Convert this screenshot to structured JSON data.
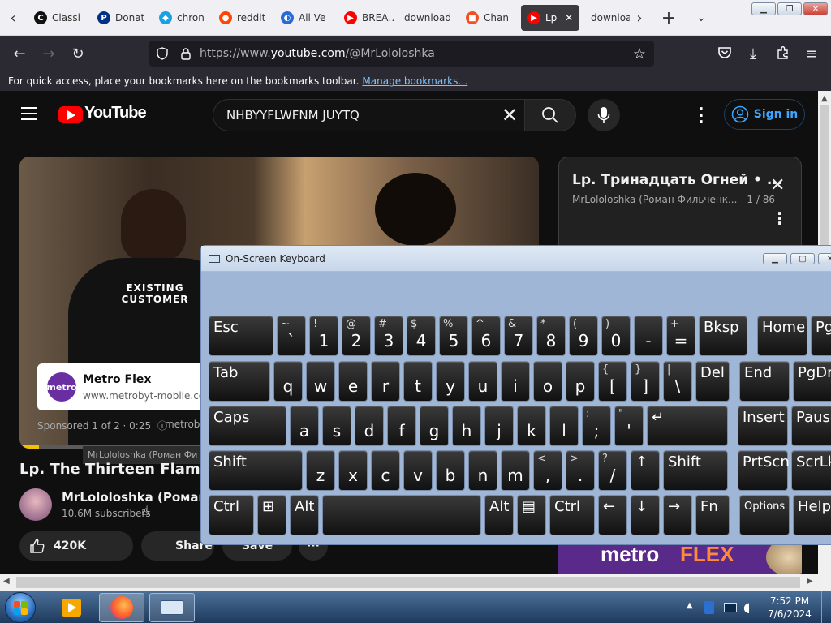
{
  "browser": {
    "tabs": [
      {
        "title": "Classi",
        "fav": "C",
        "color": "#111111"
      },
      {
        "title": "Donat",
        "fav": "P",
        "color": "#003087"
      },
      {
        "title": "chron",
        "fav": "◆",
        "color": "#19a1e2"
      },
      {
        "title": "reddit",
        "fav": "●",
        "color": "#ff4500"
      },
      {
        "title": "All Ve",
        "fav": "◐",
        "color": "#2a6ad8"
      },
      {
        "title": "BREA… AUTO",
        "fav": "▶",
        "color": "#ff0000"
      },
      {
        "title": "download",
        "fav": "",
        "color": ""
      },
      {
        "title": "Chan",
        "fav": "■",
        "color": "#f25022"
      },
      {
        "title": "Lp",
        "fav": "▶",
        "color": "#ff0000"
      },
      {
        "title": "downloa",
        "fav": "",
        "color": ""
      }
    ],
    "url_prefix": "https://www.",
    "url_domain": "youtube.com",
    "url_path": "/@MrLololoshka",
    "bookmarks_message": "For quick access, place your bookmarks here on the bookmarks toolbar.",
    "manage_bookmarks": "Manage bookmarks…"
  },
  "youtube": {
    "logo_text": "YouTube",
    "search_value": "NHBYYFLWFNM JUYTQ",
    "sign_in": "Sign in",
    "ad": {
      "title": "Metro Flex",
      "url": "www.metrobyt-mobile.com",
      "logo": "metro",
      "sponsored": "Sponsored 1 of 2 · 0:25",
      "advertiser": "metroby"
    },
    "shirt_text": "EXISTING CUSTOMER",
    "tooltip": "MrLololoshka (Роман Фи",
    "video_title": "Lp. The Thirteen Flames",
    "channel_name": "MrLololoshka (Роман Ф",
    "subscribers": "10.6M subscribers",
    "likes": "420K",
    "share": "Share",
    "save": "Save",
    "playlist_title": "Lp. Тринадцать Огней • ...",
    "playlist_sub": "MrLololoshka (Роман Фильченк...",
    "playlist_pos": " - 1 / 86",
    "banner_metro": "metro",
    "banner_flex": "FLEX"
  },
  "osk": {
    "title": "On-Screen Keyboard",
    "rows": [
      [
        {
          "main": "Esc",
          "w": 80,
          "type": "word"
        },
        {
          "main": "`",
          "shift": "~"
        },
        {
          "main": "1",
          "shift": "!"
        },
        {
          "main": "2",
          "shift": "@"
        },
        {
          "main": "3",
          "shift": "#"
        },
        {
          "main": "4",
          "shift": "$"
        },
        {
          "main": "5",
          "shift": "%"
        },
        {
          "main": "6",
          "shift": "^"
        },
        {
          "main": "7",
          "shift": "&"
        },
        {
          "main": "8",
          "shift": "*"
        },
        {
          "main": "9",
          "shift": "("
        },
        {
          "main": "0",
          "shift": ")"
        },
        {
          "main": "-",
          "shift": "_"
        },
        {
          "main": "=",
          "shift": "+"
        },
        {
          "main": "Bksp",
          "w": 60,
          "type": "word"
        },
        {
          "main": "Home",
          "w": 62,
          "type": "word",
          "gap": 8
        },
        {
          "main": "PgUp",
          "w": 62,
          "type": "word"
        }
      ],
      [
        {
          "main": "Tab",
          "w": 76,
          "type": "word"
        },
        {
          "main": "q"
        },
        {
          "main": "w"
        },
        {
          "main": "e"
        },
        {
          "main": "r"
        },
        {
          "main": "t"
        },
        {
          "main": "y"
        },
        {
          "main": "u"
        },
        {
          "main": "i"
        },
        {
          "main": "o"
        },
        {
          "main": "p"
        },
        {
          "main": "[",
          "shift": "{"
        },
        {
          "main": "]",
          "shift": "}"
        },
        {
          "main": "\\",
          "shift": "|"
        },
        {
          "main": "Del",
          "w": 42,
          "type": "word"
        },
        {
          "main": "End",
          "w": 62,
          "type": "word",
          "gap": 8
        },
        {
          "main": "PgDn",
          "w": 62,
          "type": "word"
        }
      ],
      [
        {
          "main": "Caps",
          "w": 96,
          "type": "word"
        },
        {
          "main": "a"
        },
        {
          "main": "s"
        },
        {
          "main": "d"
        },
        {
          "main": "f"
        },
        {
          "main": "g"
        },
        {
          "main": "h"
        },
        {
          "main": "j"
        },
        {
          "main": "k"
        },
        {
          "main": "l"
        },
        {
          "main": ";",
          "shift": ":"
        },
        {
          "main": "'",
          "shift": "\""
        },
        {
          "main": "↵",
          "w": 100,
          "type": "word"
        },
        {
          "main": "Insert",
          "w": 62,
          "type": "word",
          "gap": 8
        },
        {
          "main": "Pause",
          "w": 62,
          "type": "word"
        }
      ],
      [
        {
          "main": "Shift",
          "w": 116,
          "type": "word"
        },
        {
          "main": "z"
        },
        {
          "main": "x"
        },
        {
          "main": "c"
        },
        {
          "main": "v"
        },
        {
          "main": "b"
        },
        {
          "main": "n"
        },
        {
          "main": "m"
        },
        {
          "main": ",",
          "shift": "<"
        },
        {
          "main": ".",
          "shift": ">"
        },
        {
          "main": "/",
          "shift": "?"
        },
        {
          "main": "↑",
          "type": "word"
        },
        {
          "main": "Shift",
          "w": 80,
          "type": "word"
        },
        {
          "main": "PrtScn",
          "w": 62,
          "type": "word",
          "gap": 8
        },
        {
          "main": "ScrLk",
          "w": 62,
          "type": "word"
        }
      ],
      [
        {
          "main": "Ctrl",
          "w": 56,
          "type": "word"
        },
        {
          "main": "⊞",
          "type": "word"
        },
        {
          "main": "Alt",
          "w": 36,
          "type": "word"
        },
        {
          "main": "",
          "w": 196,
          "type": "word"
        },
        {
          "main": "Alt",
          "w": 36,
          "type": "word"
        },
        {
          "main": "▤",
          "type": "word"
        },
        {
          "main": "Ctrl",
          "w": 56,
          "type": "word"
        },
        {
          "main": "←",
          "type": "word"
        },
        {
          "main": "↓",
          "type": "word"
        },
        {
          "main": "→",
          "type": "word"
        },
        {
          "main": "Fn",
          "w": 42,
          "type": "word"
        },
        {
          "main": "Options",
          "w": 62,
          "type": "small",
          "gap": 8
        },
        {
          "main": "Help",
          "w": 62,
          "type": "word"
        }
      ]
    ]
  },
  "taskbar": {
    "time": "7:52 PM",
    "date": "7/6/2024"
  }
}
